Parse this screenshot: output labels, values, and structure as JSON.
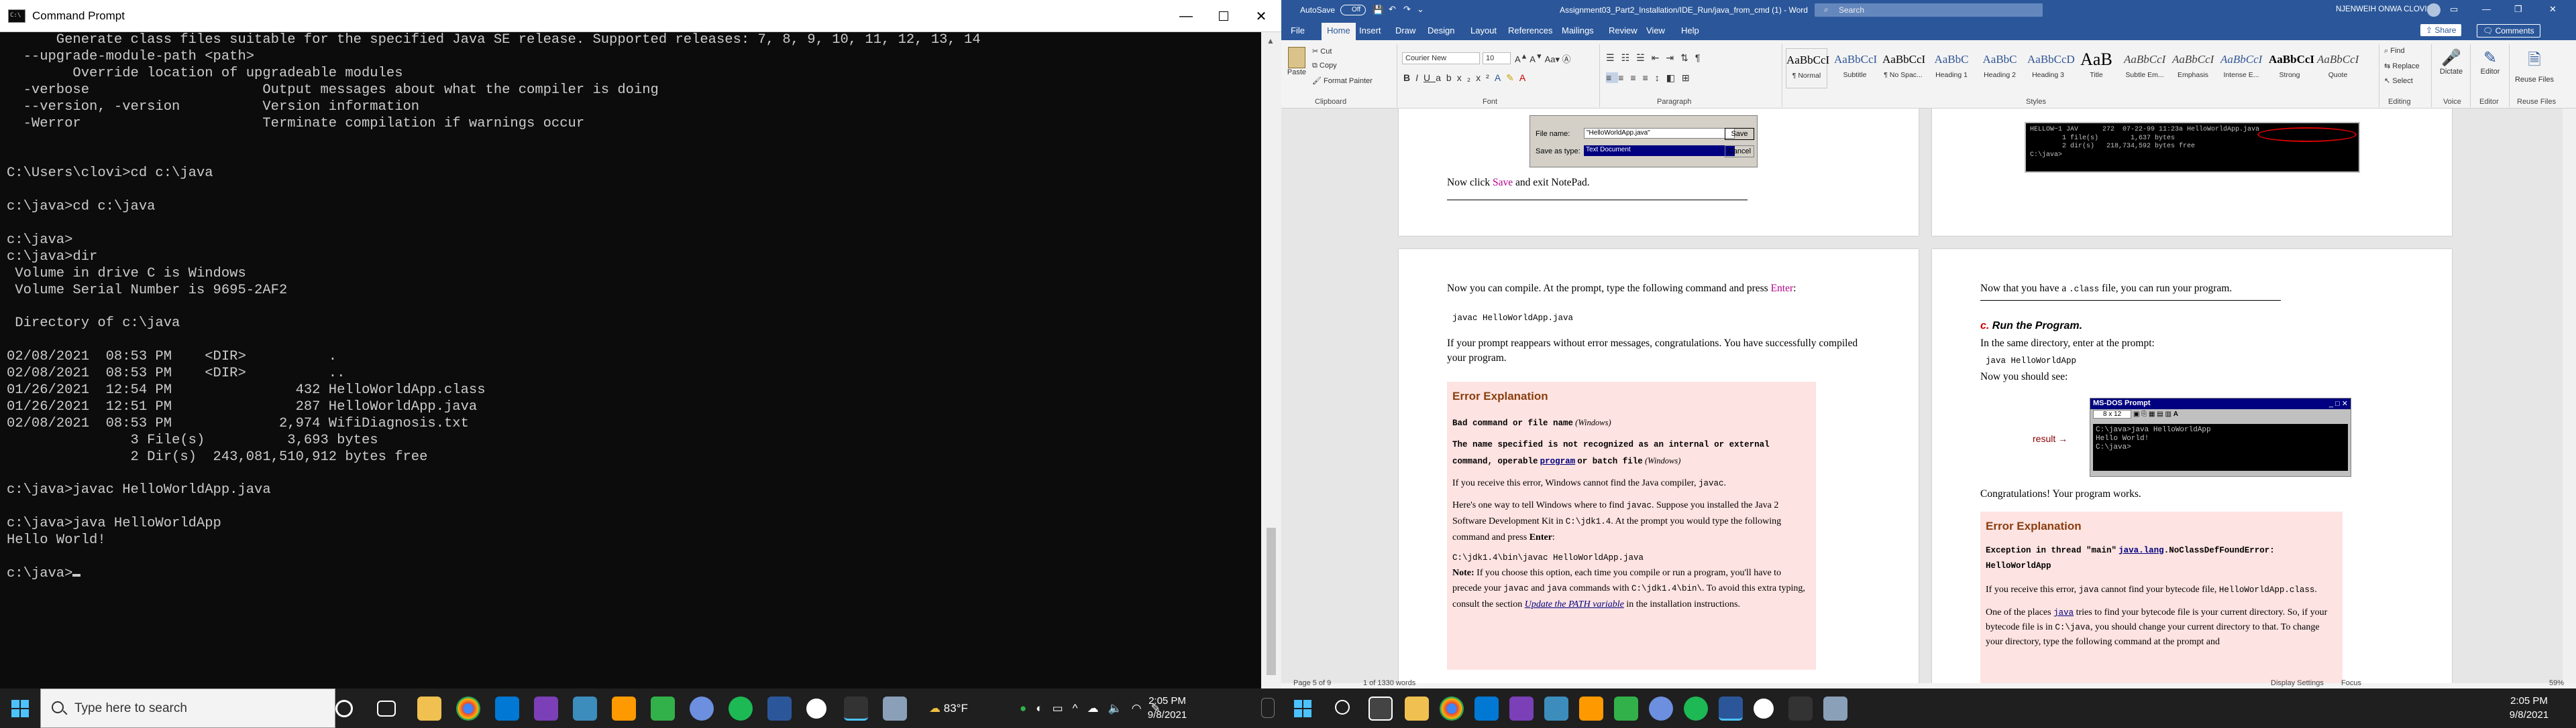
{
  "cmd": {
    "title": "Command Prompt",
    "lines": [
      "      Generate class files suitable for the specified Java SE release. Supported releases: 7, 8, 9, 10, 11, 12, 13, 14",
      "  --upgrade-module-path <path>",
      "        Override location of upgradeable modules",
      "  -verbose                     Output messages about what the compiler is doing",
      "  --version, -version          Version information",
      "  -Werror                      Terminate compilation if warnings occur",
      "",
      "",
      "C:\\Users\\clovi>cd c:\\java",
      "",
      "c:\\java>cd c:\\java",
      "",
      "c:\\java>",
      "c:\\java>dir",
      " Volume in drive C is Windows",
      " Volume Serial Number is 9695-2AF2",
      "",
      " Directory of c:\\java",
      "",
      "02/08/2021  08:53 PM    <DIR>          .",
      "02/08/2021  08:53 PM    <DIR>          ..",
      "01/26/2021  12:54 PM               432 HelloWorldApp.class",
      "01/26/2021  12:51 PM               287 HelloWorldApp.java",
      "02/08/2021  08:53 PM             2,974 WifiDiagnosis.txt",
      "               3 File(s)          3,693 bytes",
      "               2 Dir(s)  243,081,510,912 bytes free",
      "",
      "c:\\java>javac HelloWorldApp.java",
      "",
      "c:\\java>java HelloWorldApp",
      "Hello World!",
      ""
    ],
    "prompt": "c:\\java>"
  },
  "taskbar": {
    "search_placeholder": "Type here to search",
    "weather": "83°F",
    "left_clock_time": "2:05 PM",
    "left_clock_date": "9/8/2021",
    "right_clock_time": "2:05 PM",
    "right_clock_date": "9/8/2021"
  },
  "word": {
    "autosave_label": "AutoSave",
    "autosave_state": "Off",
    "doc_title": "Assignment03_Part2_Installation/IDE_Run/java_from_cmd (1) - Word",
    "search_placeholder": "Search",
    "user_name": "NJENWEIH ONWA CLOVIS",
    "tabs": [
      "File",
      "Home",
      "Insert",
      "Draw",
      "Design",
      "Layout",
      "References",
      "Mailings",
      "Review",
      "View",
      "Help"
    ],
    "share_label": "Share",
    "comments_label": "Comments",
    "clipboard": {
      "paste": "Paste",
      "cut": "Cut",
      "copy": "Copy",
      "format_painter": "Format Painter",
      "group": "Clipboard"
    },
    "font": {
      "name": "Courier New",
      "size": "10",
      "group": "Font"
    },
    "paragraph_group": "Paragraph",
    "styles": [
      {
        "prev": "AaBbCcI",
        "name": "¶ Normal"
      },
      {
        "prev": "AaBbCcI",
        "name": "Subtitle"
      },
      {
        "prev": "AaBbCcI",
        "name": "¶ No Spac..."
      },
      {
        "prev": "AaBbC",
        "name": "Heading 1"
      },
      {
        "prev": "AaBbC",
        "name": "Heading 2"
      },
      {
        "prev": "AaBbCcD",
        "name": "Heading 3"
      },
      {
        "prev": "AaB",
        "name": "Title"
      },
      {
        "prev": "AaBbCcI",
        "name": "Subtle Em..."
      },
      {
        "prev": "AaBbCcI",
        "name": "Emphasis"
      },
      {
        "prev": "AaBbCcI",
        "name": "Intense E..."
      },
      {
        "prev": "AaBbCcI",
        "name": "Strong"
      },
      {
        "prev": "AaBbCcI",
        "name": "Quote"
      }
    ],
    "styles_group": "Styles",
    "editing": {
      "find": "Find",
      "replace": "Replace",
      "select": "Select",
      "group": "Editing"
    },
    "voice": {
      "dictate": "Dictate",
      "group": "Voice"
    },
    "editor": {
      "label": "Editor",
      "group": "Editor"
    },
    "reuse": {
      "label": "Reuse Files",
      "group": "Reuse Files"
    },
    "status": {
      "page": "Page 5 of 9",
      "words": "1 of 1330 words",
      "display": "Display Settings",
      "focus": "Focus",
      "zoom": "59%"
    },
    "page1": {
      "dlg_filename_label": "File name:",
      "dlg_filename_value": "\"HelloWorldApp.java\"",
      "dlg_saveas_label": "Save as type:",
      "dlg_saveas_value": "Text Document",
      "dlg_save": "Save",
      "dlg_cancel": "Cancel",
      "now_click": "Now click",
      "save_word": "Save",
      "and_exit": "and exit NotePad."
    },
    "page2": {
      "dir_line1": "HELLOW~1 JAV      272  07-22-99 11:23a HelloWorldApp.java",
      "dir_line2": "        1 file(s)        1,637 bytes",
      "dir_line3": "        2 dir(s)   218,734,592 bytes free",
      "dir_prompt": "C:\\java>"
    },
    "page3": {
      "intro": "Now you can compile. At the prompt, type the following command and press",
      "enter_word": "Enter",
      "compile_cmd": "javac HelloWorldApp.java",
      "success": "If your prompt reappears without error messages, congratulations. You have successfully compiled your program.",
      "err_title": "Error Explanation",
      "err1_a": "Bad command or file name",
      "err1_b": "(Windows)",
      "err2_a": "The name specified is not recognized as an internal or external command, operable",
      "err2_prog": "program",
      "err2_b": "or batch file",
      "err2_c": "(Windows)",
      "p1": "If you receive this error, Windows cannot find the Java compiler,",
      "p1_code": "javac",
      "p2": "Here's one way to tell Windows where to find",
      "p2_code": "javac",
      "p2b": ". Suppose you installed the Java 2 Software Development Kit in",
      "p2_code2": "C:\\jdk1.4",
      "p2c": ". At the prompt you would type the following command and press",
      "p2_enter": "Enter",
      "p3_code": "C:\\jdk1.4\\bin\\javac HelloWorldApp.java",
      "note_label": "Note:",
      "note": "If you choose this option, each time you compile or run a program, you'll have to precede your",
      "note_code1": "javac",
      "note_and": "and",
      "note_code2": "java",
      "note_b": "commands with",
      "note_code3": "C:\\jdk1.4\\bin\\",
      "note_c": ". To avoid this extra typing, consult the section",
      "note_link": "Update the PATH variable",
      "note_d": "in the installation instructions."
    },
    "page4": {
      "intro_a": "Now that you have a",
      "intro_code": ".class",
      "intro_b": "file, you can run your program.",
      "step_label": "c.",
      "step_title": "Run the Program.",
      "same_dir": "In the same directory, enter at the prompt:",
      "run_cmd": "java HelloWorldApp",
      "should_see": "Now you should see:",
      "dos_title": "MS-DOS Prompt",
      "dos_font": "8 x 12",
      "dos_line1": "C:\\java>java HelloWorldApp",
      "dos_line2": "Hello World!",
      "dos_line3": "C:\\java>",
      "result_label": "result",
      "congrats": "Congratulations! Your program works.",
      "err_title": "Error Explanation",
      "err_a": "Exception in thread \"main\"",
      "err_link": "java.lang",
      "err_b": ".NoClassDefFoundError: HelloWorldApp",
      "p1_a": "If you receive this error,",
      "p1_code": "java",
      "p1_b": "cannot find your bytecode file,",
      "p1_code2": "HelloWorldApp.class",
      "p2_a": "One of the places",
      "p2_link": "java",
      "p2_b": "tries to find your bytecode file is your current directory. So, if your bytecode file is in",
      "p2_code": "C:\\java",
      "p2_c": ", you should change your current directory to that. To change your directory, type the following command at the prompt and"
    }
  }
}
